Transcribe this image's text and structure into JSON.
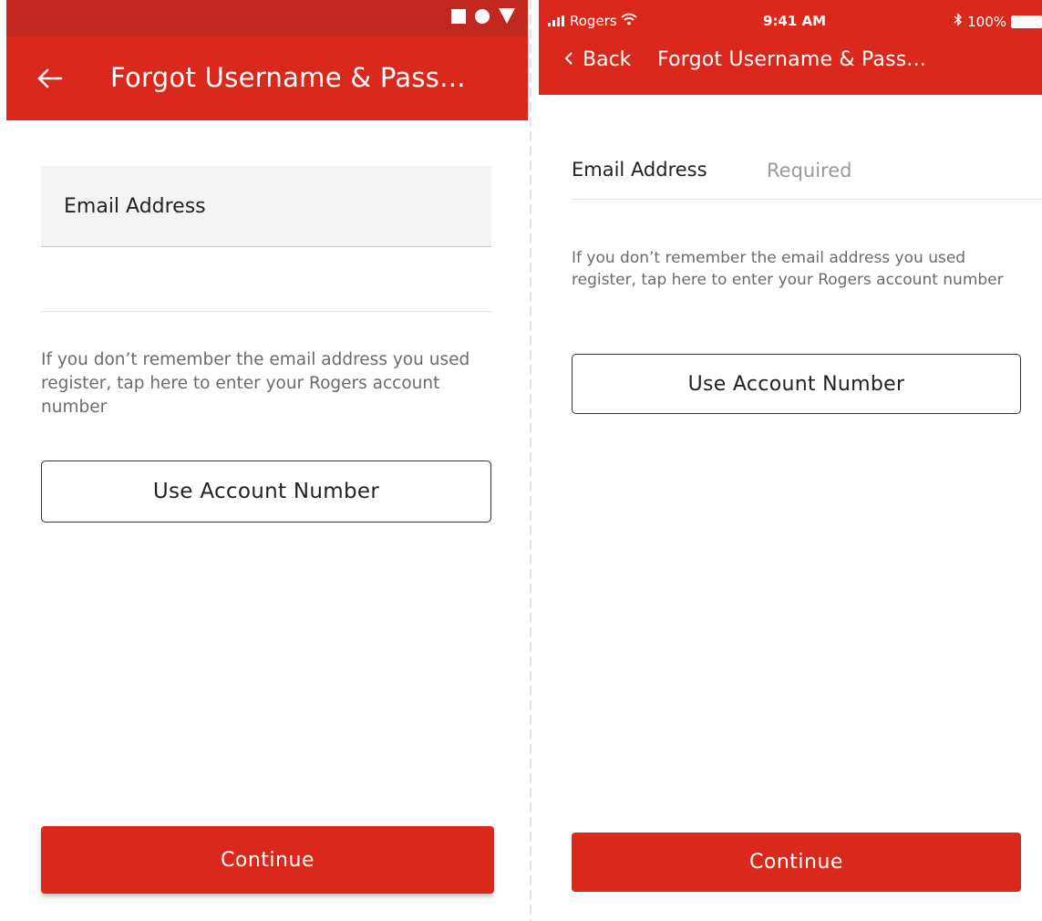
{
  "colors": {
    "brand_red": "#da291c",
    "status_bar_red": "#c1261f"
  },
  "android": {
    "status_icons": [
      "square-icon",
      "circle-icon",
      "triangle-icon"
    ],
    "app_bar": {
      "back_icon": "arrow-left-icon",
      "title": "Forgot Username & Pass..."
    },
    "email_field": {
      "label": "Email Address",
      "value": ""
    },
    "help_text": "If you don’t remember the email address you used register, tap here to enter your Rogers account number",
    "account_button": "Use Account Number",
    "continue_button": "Continue"
  },
  "ios": {
    "status_bar": {
      "carrier": "Rogers",
      "time": "9:41 AM",
      "battery": "100%",
      "icons": [
        "signal-icon",
        "wifi-icon",
        "bluetooth-icon",
        "battery-icon"
      ]
    },
    "nav": {
      "back_label": "Back",
      "title": "Forgot Username & Pass..."
    },
    "email_field": {
      "label": "Email Address",
      "placeholder": "Required",
      "value": ""
    },
    "help_text": "If you don’t remember the email address you used register, tap here to enter your Rogers account number",
    "account_button": "Use Account Number",
    "continue_button": "Continue"
  }
}
